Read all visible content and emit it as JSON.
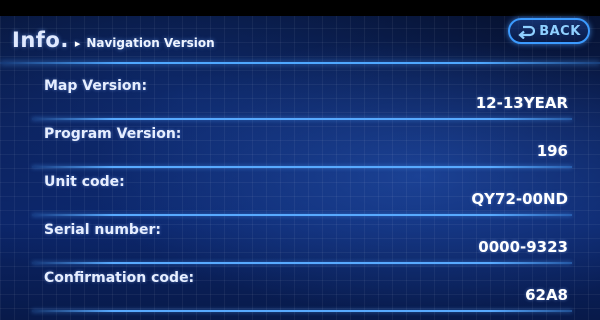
{
  "header": {
    "title": "Info.",
    "separator": "▸",
    "subtitle": "Navigation Version",
    "back_label": "BACK"
  },
  "rows": [
    {
      "label": "Map Version:",
      "value": "12-13YEAR"
    },
    {
      "label": "Program Version:",
      "value": "196"
    },
    {
      "label": "Unit code:",
      "value": "QY72-00ND"
    },
    {
      "label": "Serial number:",
      "value": "0000-9323"
    },
    {
      "label": "Confirmation code:",
      "value": "62A8"
    }
  ],
  "colors": {
    "accent": "#4fa8ff",
    "background": "#0a1d52",
    "text": "#e9f1ff"
  },
  "icons": {
    "back": "back-arrow-icon"
  }
}
